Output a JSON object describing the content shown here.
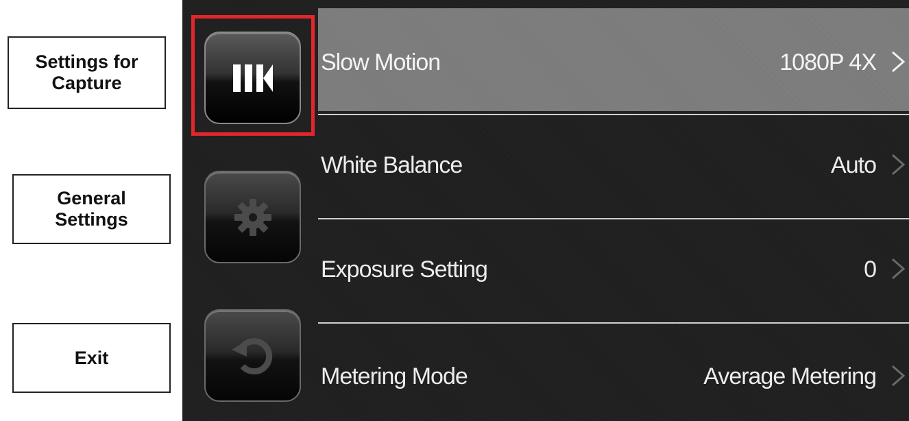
{
  "callouts": {
    "capture": "Settings for\nCapture",
    "general": "General\nSettings",
    "exit": "Exit"
  },
  "sidebar": {
    "items": [
      {
        "icon": "slow-motion-icon",
        "active": true
      },
      {
        "icon": "gear-icon",
        "active": false
      },
      {
        "icon": "back-arrow-icon",
        "active": false
      }
    ]
  },
  "menu": {
    "items": [
      {
        "label": "Slow Motion",
        "value": "1080P 4X",
        "selected": true
      },
      {
        "label": "White Balance",
        "value": "Auto",
        "selected": false
      },
      {
        "label": "Exposure Setting",
        "value": "0",
        "selected": false
      },
      {
        "label": "Metering Mode",
        "value": "Average Metering",
        "selected": false
      }
    ]
  },
  "colors": {
    "selection_frame": "#e3262b",
    "screen_background": "#1e1e1e",
    "highlight_row": "#7a7a7a",
    "text": "#ececec"
  }
}
